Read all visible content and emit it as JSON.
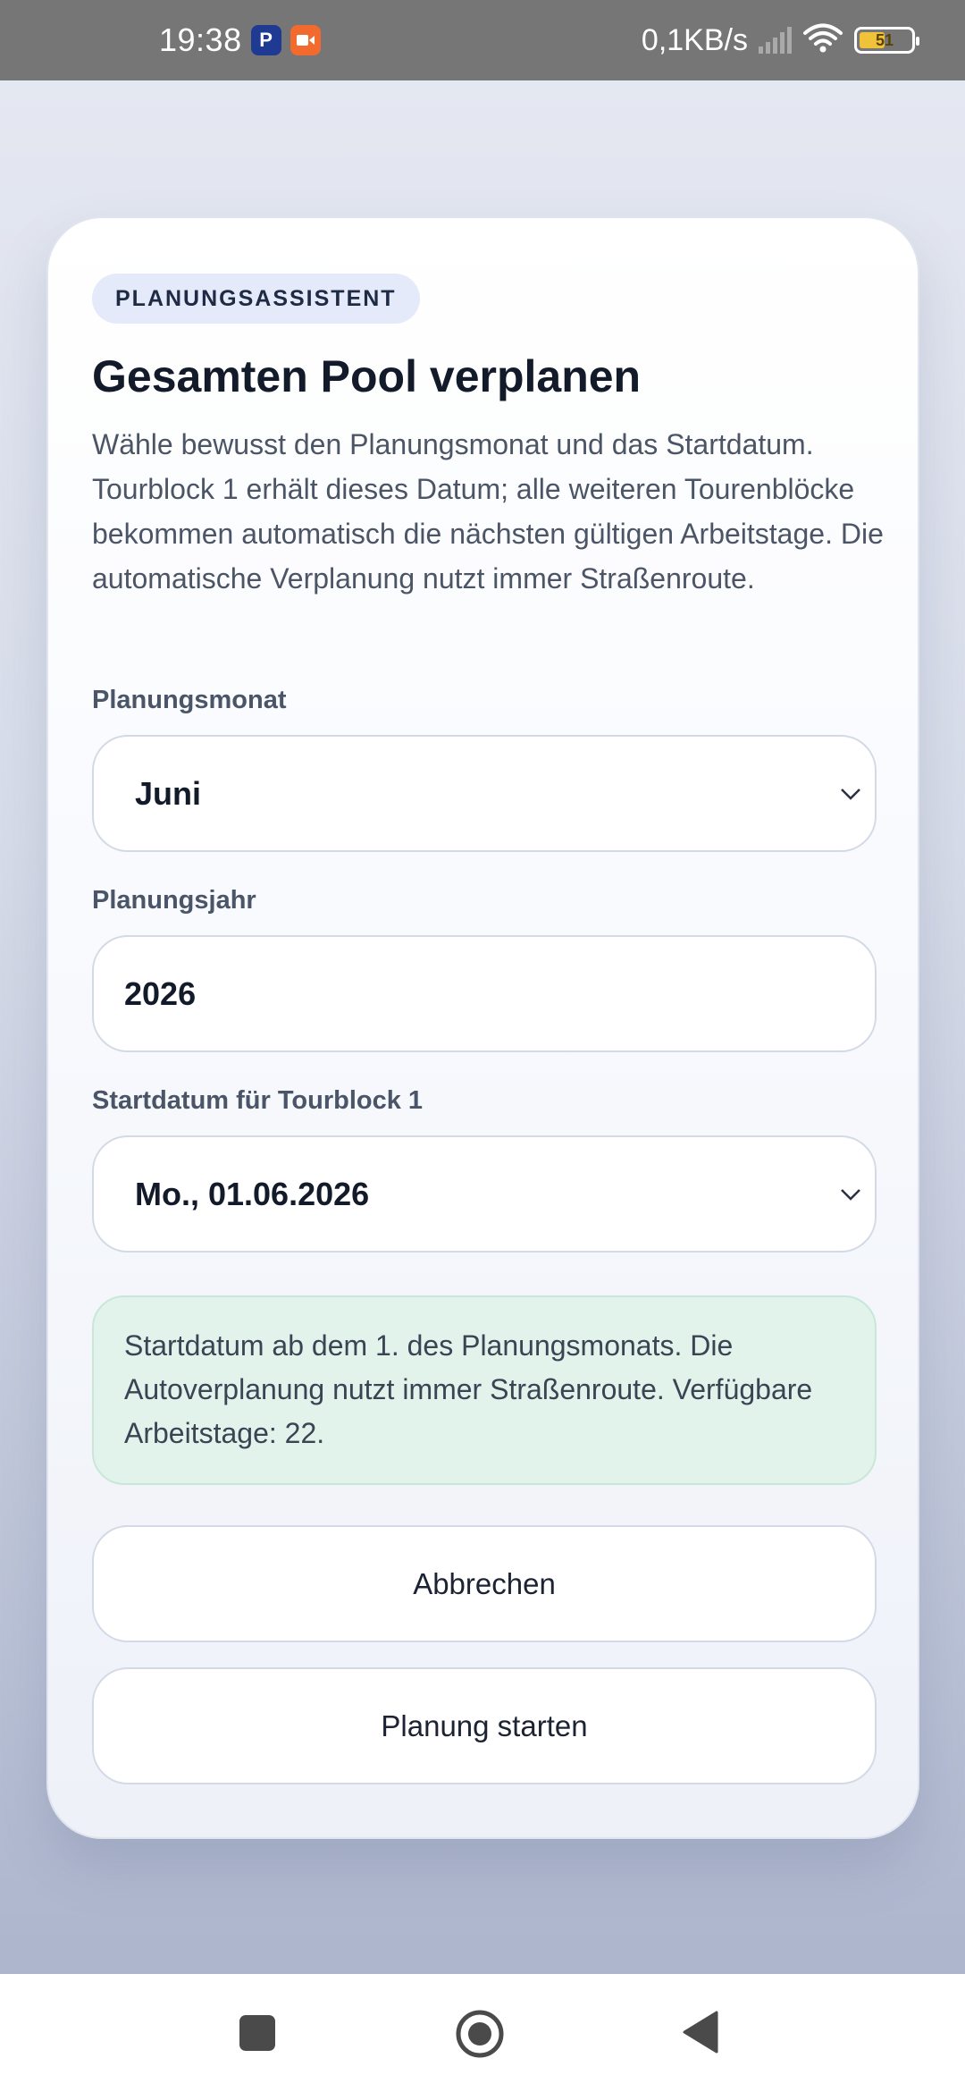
{
  "status_bar": {
    "time": "19:38",
    "net_speed": "0,1KB/s",
    "battery": "51",
    "app_icons": [
      "paypal-icon",
      "recorder-icon"
    ]
  },
  "dialog": {
    "badge": "PLANUNGSASSISTENT",
    "title": "Gesamten Pool verplanen",
    "description": "Wähle bewusst den Planungsmonat und das Startdatum. Tourblock 1 erhält dieses Datum; alle weiteren Tourenblöcke bekommen automatisch die nächsten gültigen Arbeitstage. Die automatische Verplanung nutzt immer Straßenroute.",
    "month": {
      "label": "Planungsmonat",
      "value": "Juni"
    },
    "year": {
      "label": "Planungsjahr",
      "value": "2026"
    },
    "start_date": {
      "label": "Startdatum für Tourblock 1",
      "value": "Mo., 01.06.2026"
    },
    "info": "Startdatum ab dem 1. des Planungsmonats. Die Autoverplanung nutzt immer Straßenroute. Verfügbare Arbeitstage: 22.",
    "cancel_label": "Abbrechen",
    "start_label": "Planung starten"
  },
  "colors": {
    "info_bg": "#e2f3ec",
    "badge_bg": "#e4eafa",
    "status_bar": "#767676"
  }
}
